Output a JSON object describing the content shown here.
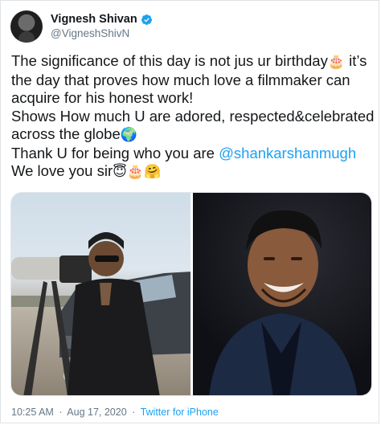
{
  "author": {
    "display_name": "Vignesh Shivan",
    "handle": "@VigneshShivN",
    "verified_icon": "verified-badge-icon",
    "verified_color": "#1da1f2"
  },
  "tweet": {
    "line1": "The significance of this day is not jus ur birthday",
    "line1_emoji": "🎂",
    "line1_tail": " it’s",
    "line2": "the day that proves how much love a filmmaker can",
    "line3": "acquire for his honest work!",
    "line4": "Shows How much U are adored, respected&celebrated",
    "line5": "across the globe",
    "line5_emoji": "🌍",
    "line6_prefix": "Thank U for being who you are ",
    "mention": "@shankarshanmugh",
    "line7": "We love you sir",
    "line7_emojis": "😇🎂🤗"
  },
  "footer": {
    "time": "10:25 AM",
    "separator": "·",
    "date": "Aug 17, 2020",
    "source": "Twitter for iPhone"
  },
  "colors": {
    "link": "#1da1f2",
    "secondary_text": "#657786",
    "primary_text": "#14171a"
  }
}
